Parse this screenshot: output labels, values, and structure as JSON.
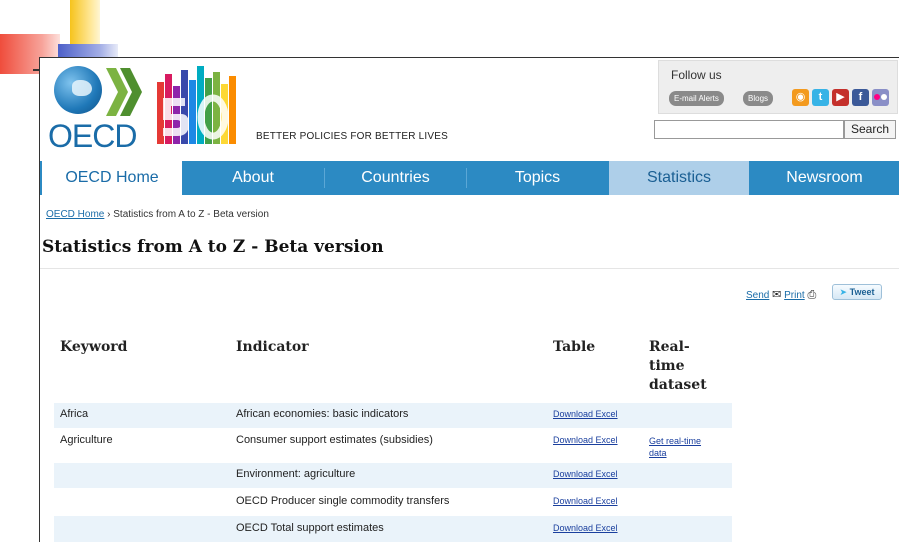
{
  "header": {
    "brand_word": "OECD",
    "tagline": "BETTER POLICIES FOR BETTER LIVES",
    "follow_label": "Follow us",
    "email_alerts": "E-mail Alerts",
    "blogs": "Blogs",
    "social_icons": [
      "rss-icon",
      "twitter-icon",
      "youtube-icon",
      "facebook-icon",
      "flickr-icon"
    ],
    "search_button": "Search",
    "search_value": ""
  },
  "nav": [
    "OECD Home",
    "About",
    "Countries",
    "Topics",
    "Statistics",
    "Newsroom"
  ],
  "breadcrumb": {
    "home": "OECD Home",
    "separator": "›",
    "current": "Statistics from A to Z - Beta version"
  },
  "page_title": "Statistics from A to Z - Beta version",
  "share": {
    "send": "Send",
    "print": "Print",
    "tweet": "Tweet"
  },
  "table": {
    "headers": {
      "keyword": "Keyword",
      "indicator": "Indicator",
      "table": "Table",
      "realtime_line1": "Real-",
      "realtime_line2": "time",
      "realtime_line3": "dataset"
    },
    "rows": [
      {
        "keyword": "Africa",
        "indicator": "African economies: basic indicators",
        "table": "Download Excel",
        "realtime_1": "",
        "realtime_2": ""
      },
      {
        "keyword": "Agriculture",
        "indicator": "Consumer support estimates (subsidies)",
        "table": "Download Excel",
        "realtime_1": "Get real-time",
        "realtime_2": "data"
      },
      {
        "keyword": "",
        "indicator": "Environment: agriculture",
        "table": "Download Excel",
        "realtime_1": "",
        "realtime_2": ""
      },
      {
        "keyword": "",
        "indicator": "OECD Producer single commodity transfers",
        "table": "Download Excel",
        "realtime_1": "",
        "realtime_2": ""
      },
      {
        "keyword": "",
        "indicator": "OECD Total support estimates",
        "table": "Download Excel",
        "realtime_1": "",
        "realtime_2": ""
      }
    ]
  },
  "colors": {
    "nav_bar": "#2c8ac3",
    "nav_statistics": "#aecfe9",
    "link": "#1a6ca8",
    "row_shade": "#eaf3fa"
  }
}
